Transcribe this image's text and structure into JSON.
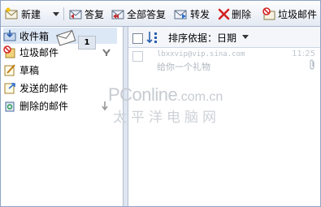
{
  "toolbar": {
    "new_label": "新建",
    "reply_label": "答复",
    "reply_all_label": "全部答复",
    "forward_label": "转发",
    "delete_label": "删除",
    "junk_label": "垃圾邮件"
  },
  "sidebar": {
    "items": [
      {
        "label": "收件箱"
      },
      {
        "label": "垃圾邮件"
      },
      {
        "label": "草稿"
      },
      {
        "label": "发送的邮件"
      },
      {
        "label": "删除的邮件"
      }
    ]
  },
  "drag": {
    "count": "1"
  },
  "list": {
    "sort_label": "排序依据：日期",
    "messages": [
      {
        "sender": "lbxxvip@vip.sina.com",
        "subject": "给你一个礼物",
        "time": "11:25"
      }
    ]
  },
  "watermark": {
    "brand": "PConline",
    "domain": ".com.cn",
    "cn": "太平洋电脑网"
  },
  "colors": {
    "accent": "#dde8f6",
    "border": "#8fa4c4",
    "delete": "#d22020"
  }
}
